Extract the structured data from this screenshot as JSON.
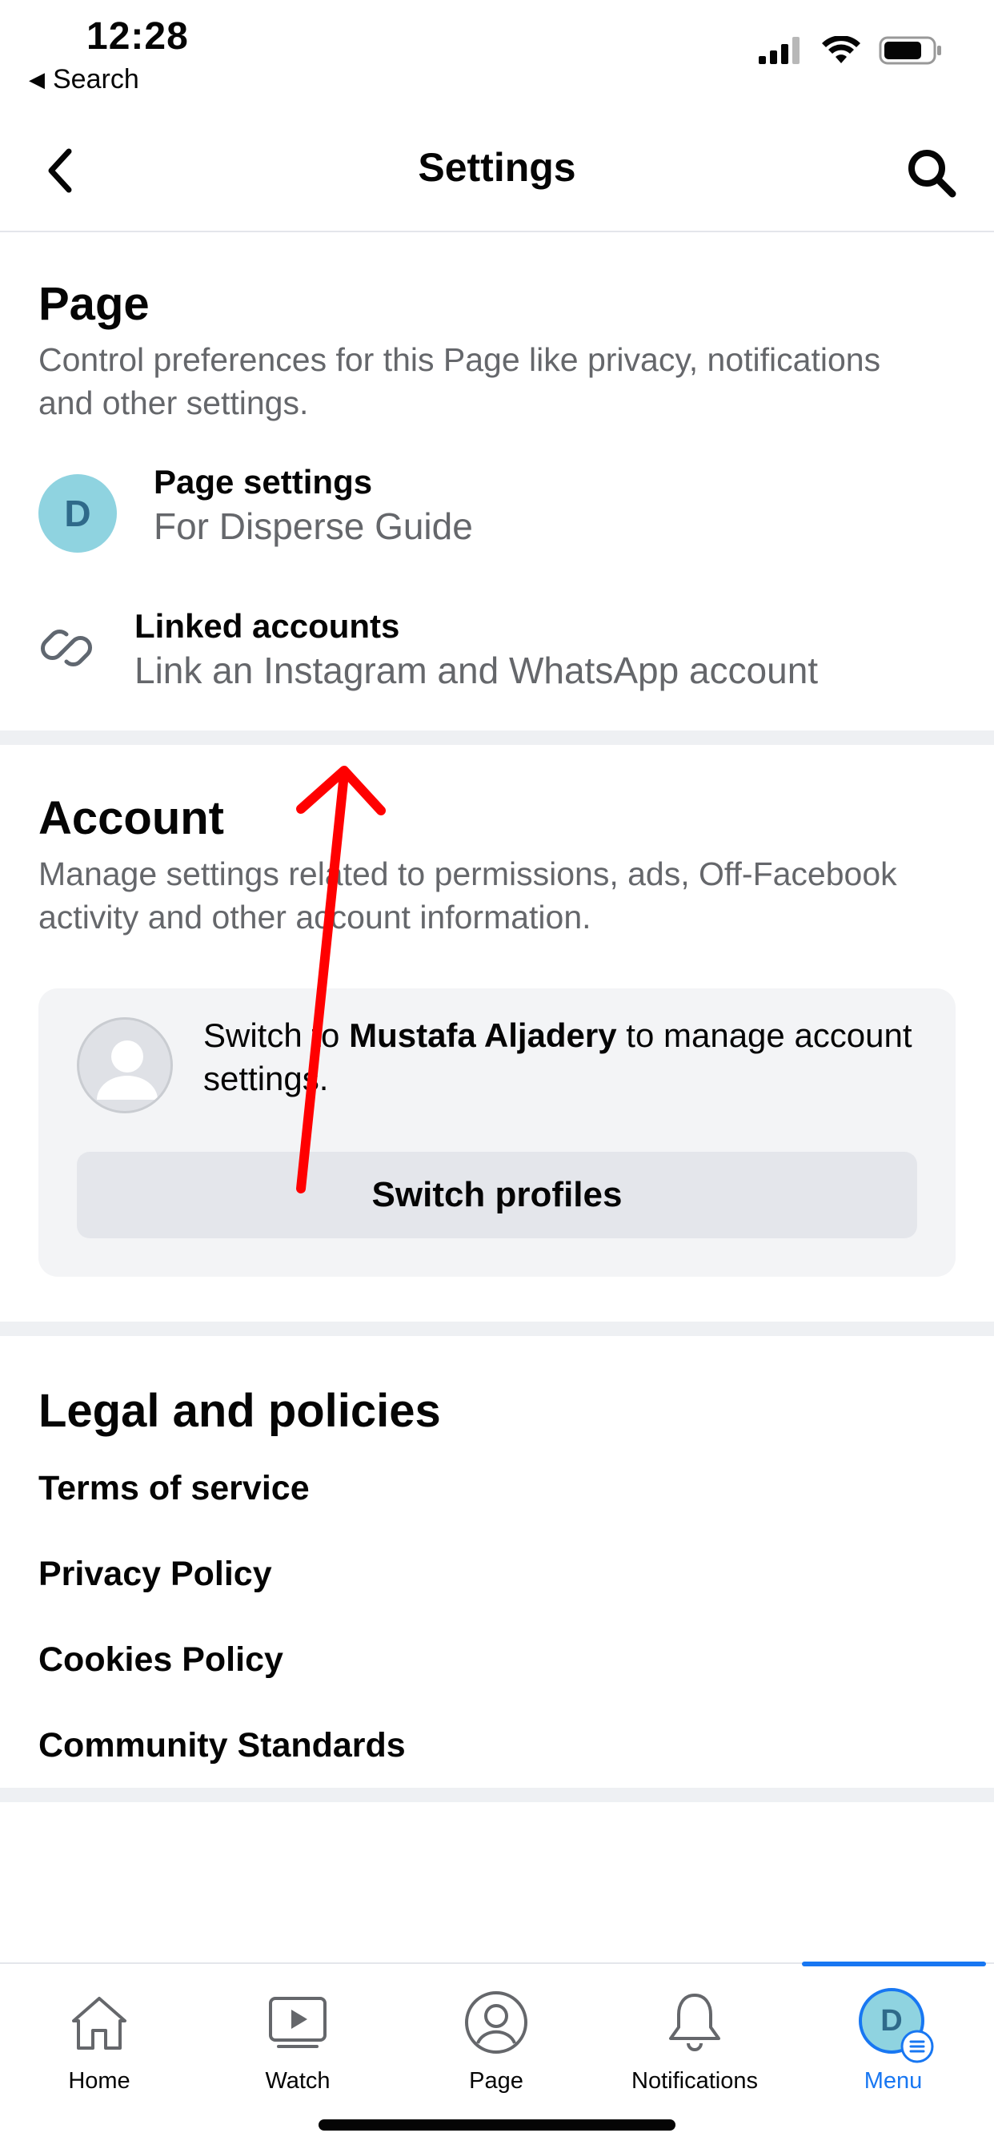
{
  "status_bar": {
    "time": "12:28",
    "back_label": "Search"
  },
  "header": {
    "title": "Settings"
  },
  "page_section": {
    "heading": "Page",
    "description": "Control preferences for this Page like privacy, notifications and other settings.",
    "items": [
      {
        "title": "Page settings",
        "subtitle": "For Disperse Guide",
        "avatar_letter": "D"
      },
      {
        "title": "Linked accounts",
        "subtitle": "Link an Instagram and WhatsApp account"
      }
    ]
  },
  "account_section": {
    "heading": "Account",
    "description": "Manage settings related to permissions, ads, Off-Facebook activity and other account information.",
    "switch_prefix": "Switch to ",
    "switch_name": "Mustafa Aljadery",
    "switch_suffix": " to manage account settings.",
    "switch_button": "Switch profiles"
  },
  "legal_section": {
    "heading": "Legal and policies",
    "links": [
      "Terms of service",
      "Privacy Policy",
      "Cookies Policy",
      "Community Standards"
    ]
  },
  "tabbar": {
    "tabs": [
      {
        "label": "Home",
        "icon": "home-icon"
      },
      {
        "label": "Watch",
        "icon": "watch-icon"
      },
      {
        "label": "Page",
        "icon": "page-icon"
      },
      {
        "label": "Notifications",
        "icon": "bell-icon"
      },
      {
        "label": "Menu",
        "icon": "menu-avatar-icon",
        "avatar_letter": "D",
        "active": true
      }
    ]
  },
  "colors": {
    "accent": "#1877f2",
    "annotation_arrow": "#ff0000",
    "secondary_text": "#65676b"
  }
}
